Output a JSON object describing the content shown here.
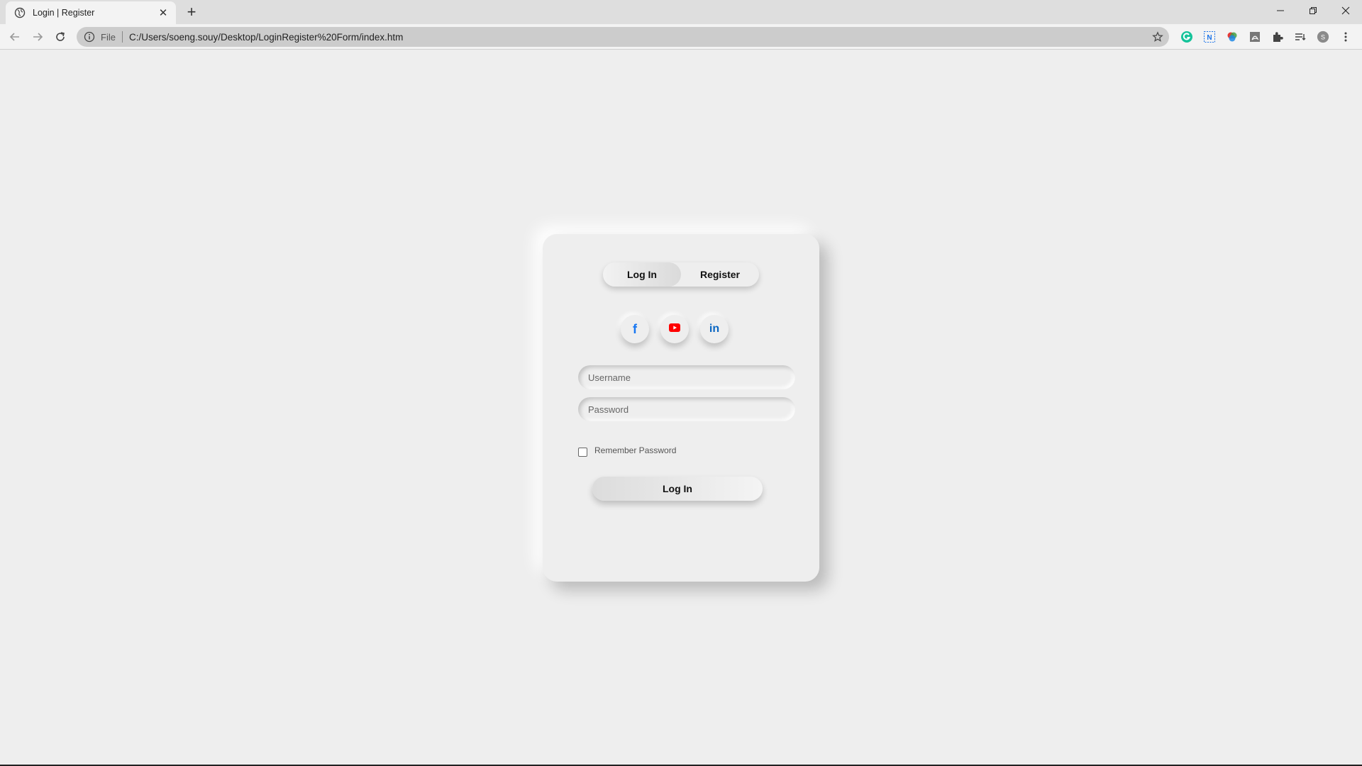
{
  "browser": {
    "tab_title": "Login | Register",
    "new_tab_label": "+",
    "omnibox_scheme": "File",
    "url": "C:/Users/soeng.souy/Desktop/LoginRegister%20Form/index.htm",
    "profile_initial": "S"
  },
  "form": {
    "tabs": {
      "login": "Log In",
      "register": "Register",
      "active": "login"
    },
    "social": [
      {
        "name": "facebook",
        "glyph": "f",
        "color": "#1877f2"
      },
      {
        "name": "youtube",
        "glyph": "youtube-icon",
        "color": "#ff0000"
      },
      {
        "name": "linkedin",
        "glyph": "in",
        "color": "#0a66c2"
      }
    ],
    "username_placeholder": "Username",
    "password_placeholder": "Password",
    "remember_label": "Remember Password",
    "remember_checked": false,
    "submit_label": "Log In"
  }
}
